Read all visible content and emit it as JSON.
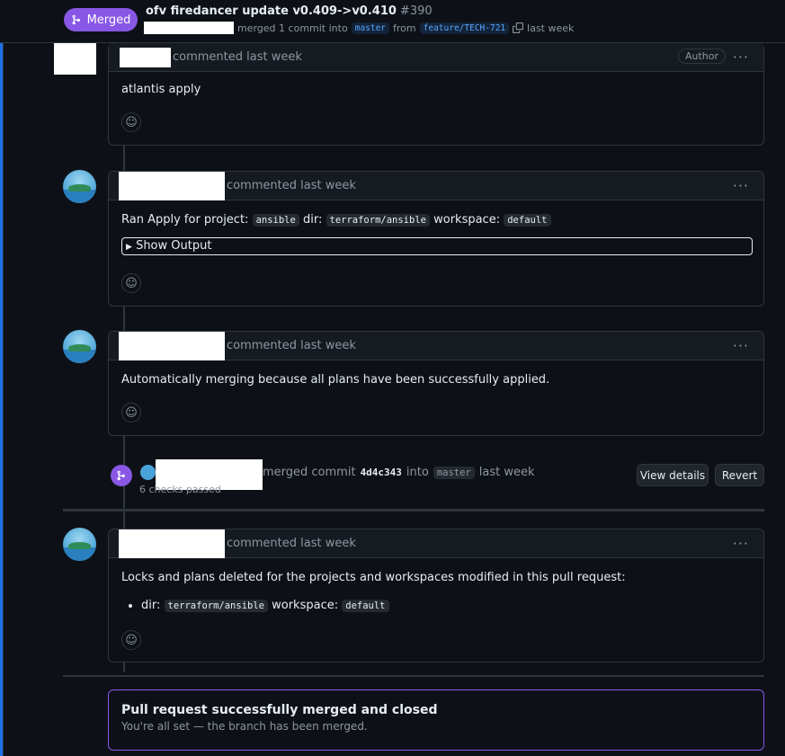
{
  "header": {
    "badge_label": "Merged",
    "title": "ofv firedancer update v0.409->v0.410",
    "number": "#390",
    "merge_text": "merged 1 commit into",
    "base_branch": "master",
    "from_label": "from",
    "head_branch": "feature/TECH-721",
    "time": "last week"
  },
  "comments": [
    {
      "action": "commented last week",
      "badge": "Author",
      "body": "atlantis apply"
    },
    {
      "action": "commented last week",
      "body_prefix": "Ran Apply for project:",
      "project": "ansible",
      "dir_label": "dir:",
      "dir": "terraform/ansible",
      "workspace_label": "workspace:",
      "workspace": "default",
      "details_label": "Show Output"
    },
    {
      "action": "commented last week",
      "body": "Automatically merging because all plans have been successfully applied."
    },
    {
      "action": "commented last week",
      "body": "Locks and plans deleted for the projects and workspaces modified in this pull request:",
      "item_dir_label": "dir:",
      "item_dir": "terraform/ansible",
      "item_workspace_label": "workspace:",
      "item_workspace": "default"
    }
  ],
  "merge_event": {
    "text": "merged commit",
    "sha": "4d4c343",
    "into_label": "into",
    "branch": "master",
    "time": "last week",
    "checks": "6 checks passed",
    "view_details_label": "View details",
    "revert_label": "Revert"
  },
  "merged_box": {
    "title": "Pull request successfully merged and closed",
    "subtitle": "You're all set — the branch has been merged."
  },
  "more_label": "···"
}
